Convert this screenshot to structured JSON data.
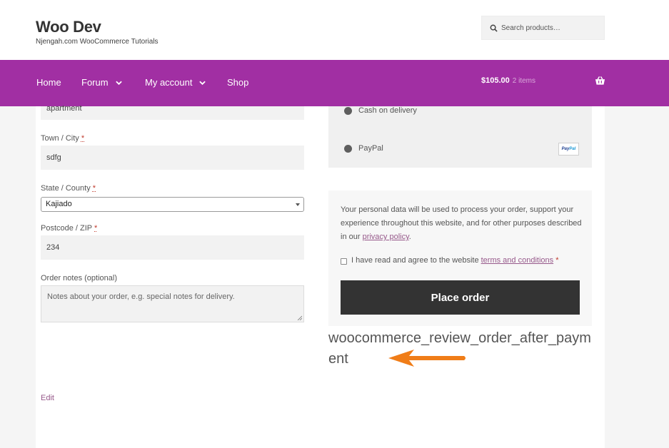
{
  "header": {
    "site_title": "Woo Dev",
    "tagline": "Njengah.com WooCommerce Tutorials",
    "search_placeholder": "Search products…"
  },
  "nav": {
    "items": [
      {
        "label": "Home",
        "has_dropdown": false
      },
      {
        "label": "Forum",
        "has_dropdown": true
      },
      {
        "label": "My account",
        "has_dropdown": true
      },
      {
        "label": "Shop",
        "has_dropdown": false
      }
    ],
    "cart_total": "$105.00",
    "cart_count": "2 items"
  },
  "form": {
    "address2_value": "apartment",
    "town_label": "Town / City",
    "town_value": "sdfg",
    "state_label": "State / County",
    "state_value": "Kajiado",
    "postcode_label": "Postcode / ZIP",
    "postcode_value": "234",
    "notes_label": "Order notes (optional)",
    "notes_placeholder": "Notes about your order, e.g. special notes for delivery.",
    "required_mark": "*",
    "edit_label": "Edit"
  },
  "payment": {
    "methods": [
      {
        "label": "Cash on delivery"
      },
      {
        "label": "PayPal",
        "logo_text_1": "Pay",
        "logo_text_2": "Pal"
      }
    ]
  },
  "order": {
    "privacy_text_before": "Your personal data will be used to process your order, support your experience throughout this website, and for other purposes described in our ",
    "privacy_link": "privacy policy",
    "privacy_text_after": ".",
    "terms_before": "I have read and agree to the website ",
    "terms_link": "terms and conditions",
    "terms_required": "*",
    "place_order_label": "Place order"
  },
  "annotation": {
    "hook_name": "woocommerce_review_order_after_payment",
    "arrow_color": "#f07d18"
  },
  "colors": {
    "brand_purple": "#a12fa3",
    "link": "#96588a",
    "button_dark": "#333333"
  }
}
